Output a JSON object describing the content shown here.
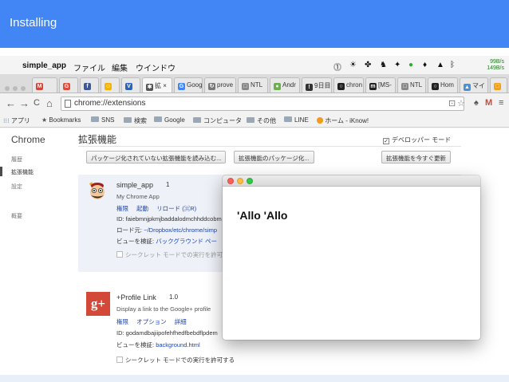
{
  "slide": {
    "title": "Installing"
  },
  "menubar": {
    "app_name": "simple_app",
    "items": [
      "ファイル",
      "編集",
      "ウインドウ"
    ],
    "netspeed_up": "99B/s",
    "netspeed_down": "149B/s"
  },
  "tabs": [
    {
      "label": "",
      "icon": "M",
      "color": "#d44638"
    },
    {
      "label": "",
      "icon": "G",
      "color": "#dd4b39"
    },
    {
      "label": "",
      "icon": "f",
      "color": "#3b5998"
    },
    {
      "label": "",
      "icon": "☺",
      "color": "#f3b300"
    },
    {
      "label": "",
      "icon": "V",
      "color": "#2a64b8"
    },
    {
      "label": "拡 ×",
      "icon": "✱",
      "color": "#555555"
    },
    {
      "label": "Goog",
      "icon": "G",
      "color": "#4285f4"
    },
    {
      "label": "prove",
      "icon": "↻",
      "color": "#777777"
    },
    {
      "label": "NTL",
      "icon": "□",
      "color": "#888888"
    },
    {
      "label": "Andr",
      "icon": "●",
      "color": "#6ab04c"
    },
    {
      "label": "9日目",
      "icon": "!",
      "color": "#333333"
    },
    {
      "label": "chron",
      "icon": "○",
      "color": "#222222"
    },
    {
      "label": "[MS-",
      "icon": "m",
      "color": "#222222"
    },
    {
      "label": "NTL",
      "icon": "□",
      "color": "#888888"
    },
    {
      "label": "Hom",
      "icon": "○",
      "color": "#222222"
    },
    {
      "label": "マイ",
      "icon": "▲",
      "color": "#4a90d9"
    },
    {
      "label": "",
      "icon": "□",
      "color": "#f0a020"
    }
  ],
  "toolbar": {
    "url": "chrome://extensions",
    "back": "←",
    "forward": "→",
    "reload": "C",
    "home": "⌂"
  },
  "bookmarks": [
    "アプリ",
    "Bookmarks",
    "SNS",
    "検索",
    "Google",
    "コンピュータ",
    "その他",
    "LINE",
    "ホーム - iKnow!"
  ],
  "sidebar": {
    "title": "Chrome",
    "items": [
      "履歴",
      "拡張機能",
      "設定",
      "概要"
    ]
  },
  "extensions_page": {
    "title": "拡張機能",
    "developer_mode": "デベロッパー モード",
    "developer_mode_checked": "✓",
    "buttons": [
      "パッケージ化されていない拡張機能を読み込む...",
      "拡張機能のパッケージ化...",
      "拡張機能を今すぐ更新"
    ]
  },
  "ext1": {
    "name": "simple_app",
    "version": "1",
    "desc": "My Chrome App",
    "links": [
      "権限",
      "起動",
      "リロード (⌘R)"
    ],
    "id": "ID: faiebmnjpkmjbaddalodmchhddcobm",
    "load_label": "ロード元:",
    "load_path": "~/Dropbox/etc/chrome/simp",
    "view_label": "ビューを検証:",
    "view_link": "バックグラウンド ペー",
    "incognito": "シークレット モードでの実行を許可"
  },
  "ext2": {
    "name": "+Profile Link",
    "version": "1.0",
    "icon_text": "g+",
    "desc": "Display a link to the Google+ profile",
    "links": [
      "権限",
      "オプション",
      "詳細"
    ],
    "id": "ID: godamdbajiipofehfhedfbebdflpdem",
    "view_label": "ビューを検証:",
    "view_link": "background.html",
    "incognito": "シークレット モードでの実行を許可する"
  },
  "popup": {
    "text": "'Allo 'Allo"
  }
}
